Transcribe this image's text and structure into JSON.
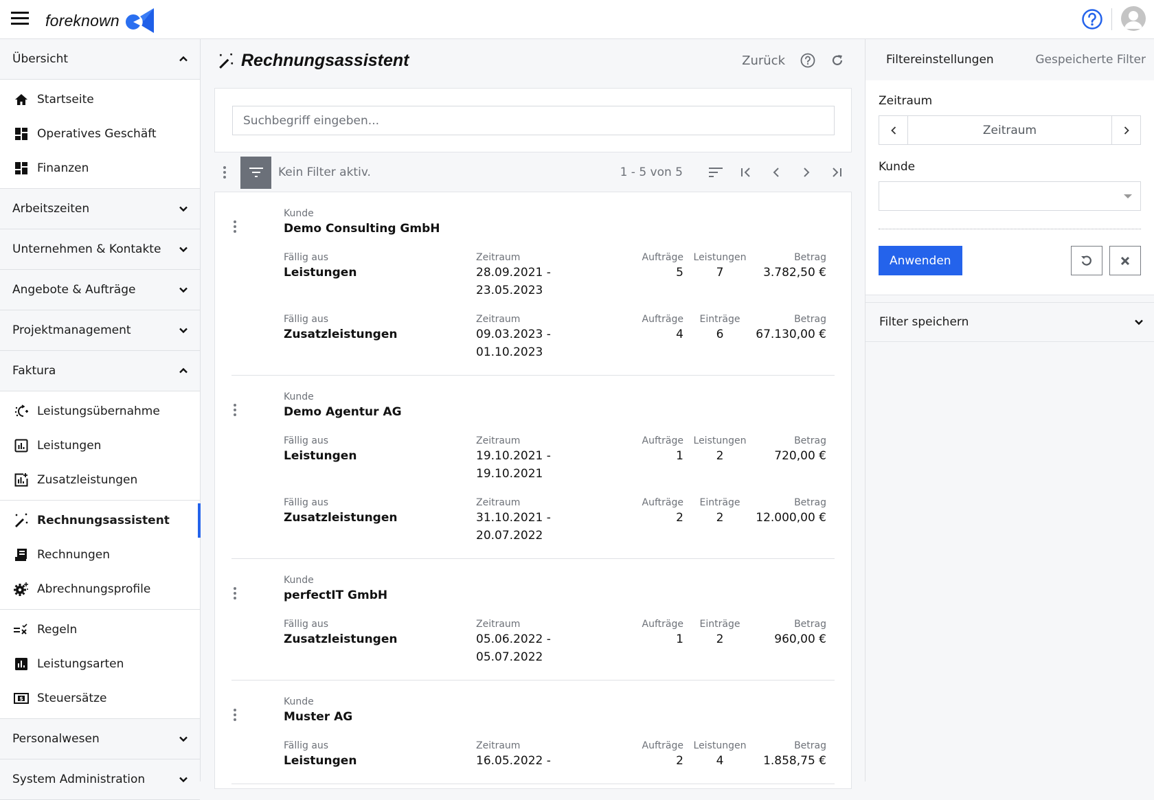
{
  "app": {
    "brand": "foreknown",
    "brand_color": "#2463eb"
  },
  "topbar": {
    "menu_icon": "hamburger-icon",
    "help_icon": "help-circle-icon",
    "avatar_icon": "user-avatar-icon"
  },
  "sidebar": {
    "sections": [
      {
        "label": "Übersicht",
        "expanded": true,
        "items": [
          {
            "label": "Startseite",
            "icon": "home-icon"
          },
          {
            "label": "Operatives Geschäft",
            "icon": "dashboard-icon"
          },
          {
            "label": "Finanzen",
            "icon": "dashboard-icon"
          }
        ]
      },
      {
        "label": "Arbeitszeiten",
        "expanded": false
      },
      {
        "label": "Unternehmen & Kontakte",
        "expanded": false
      },
      {
        "label": "Angebote & Aufträge",
        "expanded": false
      },
      {
        "label": "Projektmanagement",
        "expanded": false
      },
      {
        "label": "Faktura",
        "expanded": true,
        "groups": [
          [
            {
              "label": "Leistungsübernahme",
              "icon": "auto-import-icon"
            },
            {
              "label": "Leistungen",
              "icon": "chart-box-icon"
            },
            {
              "label": "Zusatzleistungen",
              "icon": "chart-box-plus-icon"
            }
          ],
          [
            {
              "label": "Rechnungsassistent",
              "icon": "magic-wand-icon",
              "active": true
            },
            {
              "label": "Rechnungen",
              "icon": "receipt-icon"
            },
            {
              "label": "Abrechnungsprofile",
              "icon": "gear-sparkle-icon"
            }
          ],
          [
            {
              "label": "Regeln",
              "icon": "rules-icon"
            },
            {
              "label": "Leistungsarten",
              "icon": "chart-filled-icon"
            },
            {
              "label": "Steuersätze",
              "icon": "dollar-box-icon"
            }
          ]
        ]
      },
      {
        "label": "Personalwesen",
        "expanded": false
      },
      {
        "label": "System Administration",
        "expanded": false
      }
    ]
  },
  "main": {
    "title": "Rechnungsassistent",
    "back_label": "Zurück",
    "search_placeholder": "Suchbegriff eingeben...",
    "search_value": "",
    "filter_status": "Kein Filter aktiv.",
    "pagination": "1 - 5 von 5",
    "cards": [
      {
        "customer_label": "Kunde",
        "customer": "Demo Consulting GmbH",
        "rows": [
          {
            "src_label": "Fällig aus",
            "src": "Leistungen",
            "period_label": "Zeitraum",
            "period_from": "28.09.2021 -",
            "period_to": "23.05.2023",
            "orders_label": "Aufträge",
            "orders": "5",
            "count_label": "Leistungen",
            "count": "7",
            "amount_label": "Betrag",
            "amount": "3.782,50 €"
          },
          {
            "src_label": "Fällig aus",
            "src": "Zusatzleistungen",
            "period_label": "Zeitraum",
            "period_from": "09.03.2023 -",
            "period_to": "01.10.2023",
            "orders_label": "Aufträge",
            "orders": "4",
            "count_label": "Einträge",
            "count": "6",
            "amount_label": "Betrag",
            "amount": "67.130,00 €"
          }
        ]
      },
      {
        "customer_label": "Kunde",
        "customer": "Demo Agentur AG",
        "rows": [
          {
            "src_label": "Fällig aus",
            "src": "Leistungen",
            "period_label": "Zeitraum",
            "period_from": "19.10.2021 -",
            "period_to": "19.10.2021",
            "orders_label": "Aufträge",
            "orders": "1",
            "count_label": "Leistungen",
            "count": "2",
            "amount_label": "Betrag",
            "amount": "720,00 €"
          },
          {
            "src_label": "Fällig aus",
            "src": "Zusatzleistungen",
            "period_label": "Zeitraum",
            "period_from": "31.10.2021 -",
            "period_to": "20.07.2022",
            "orders_label": "Aufträge",
            "orders": "2",
            "count_label": "Einträge",
            "count": "2",
            "amount_label": "Betrag",
            "amount": "12.000,00 €"
          }
        ]
      },
      {
        "customer_label": "Kunde",
        "customer": "perfectIT GmbH",
        "rows": [
          {
            "src_label": "Fällig aus",
            "src": "Zusatzleistungen",
            "period_label": "Zeitraum",
            "period_from": "05.06.2022 -",
            "period_to": "05.07.2022",
            "orders_label": "Aufträge",
            "orders": "1",
            "count_label": "Einträge",
            "count": "2",
            "amount_label": "Betrag",
            "amount": "960,00 €"
          }
        ]
      },
      {
        "customer_label": "Kunde",
        "customer": "Muster AG",
        "rows": [
          {
            "src_label": "Fällig aus",
            "src": "Leistungen",
            "period_label": "Zeitraum",
            "period_from": "16.05.2022 -",
            "period_to": "",
            "orders_label": "Aufträge",
            "orders": "2",
            "count_label": "Leistungen",
            "count": "4",
            "amount_label": "Betrag",
            "amount": "1.858,75 €"
          }
        ]
      }
    ]
  },
  "filter_panel": {
    "tabs": [
      {
        "label": "Filtereinstellungen",
        "active": true
      },
      {
        "label": "Gespeicherte Filter",
        "active": false
      }
    ],
    "period_label": "Zeitraum",
    "period_value": "Zeitraum",
    "customer_label": "Kunde",
    "customer_value": "",
    "apply_label": "Anwenden",
    "save_filter_label": "Filter speichern"
  }
}
